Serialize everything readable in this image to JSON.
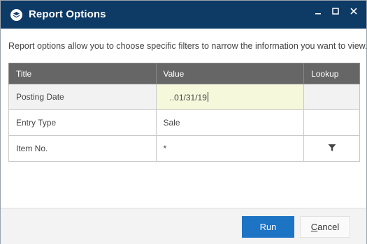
{
  "window": {
    "title": "Report Options",
    "icon": "dynamics-logo-icon",
    "controls": {
      "minimize": "–",
      "maximize": "□",
      "close": "✕"
    }
  },
  "description": "Report options allow you to choose specific filters to narrow the information you want to view.",
  "grid": {
    "headers": {
      "title": "Title",
      "value": "Value",
      "lookup": "Lookup"
    },
    "rows": [
      {
        "title": "Posting Date",
        "value": "..01/31/19",
        "lookup_icon": "",
        "selected": true
      },
      {
        "title": "Entry Type",
        "value": "Sale",
        "lookup_icon": "",
        "selected": false
      },
      {
        "title": "Item No.",
        "value": "*",
        "lookup_icon": "filter-icon",
        "selected": false
      }
    ]
  },
  "footer": {
    "run_label": "Run",
    "cancel_mnemonic": "C",
    "cancel_rest": "ancel"
  },
  "colors": {
    "titlebar": "#0e3a66",
    "header_bg": "#666666",
    "selected_value_bg": "#f6f8dc",
    "run_button": "#1d73c4"
  }
}
